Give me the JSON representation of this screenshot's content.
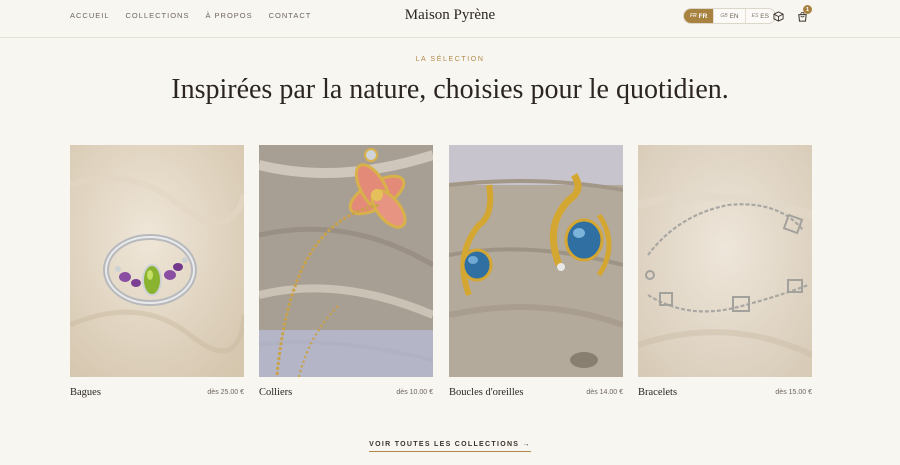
{
  "header": {
    "nav": [
      "ACCUEIL",
      "COLLECTIONS",
      "À PROPOS",
      "CONTACT"
    ],
    "brand": "Maison Pyrène",
    "languages": [
      {
        "flag": "FR",
        "label": "FR",
        "active": true
      },
      {
        "flag": "GB",
        "label": "EN",
        "active": false
      },
      {
        "flag": "ES",
        "label": "ES",
        "active": false
      }
    ],
    "cart_count": "1",
    "icons": {
      "cube": "cube-icon",
      "cart": "shopping-bag-icon"
    },
    "accent_color": "#a88240"
  },
  "hero": {
    "eyebrow": "LA SÉLECTION",
    "headline": "Inspirées par la nature, choisies pour le quotidien."
  },
  "products": [
    {
      "name": "Bagues",
      "price": "dès 25.00 €"
    },
    {
      "name": "Colliers",
      "price": "dès 10.00 €"
    },
    {
      "name": "Boucles d'oreilles",
      "price": "dès 14.00 €"
    },
    {
      "name": "Bracelets",
      "price": "dès 15.00 €"
    }
  ],
  "view_all": "VOIR TOUTES LES COLLECTIONS →"
}
